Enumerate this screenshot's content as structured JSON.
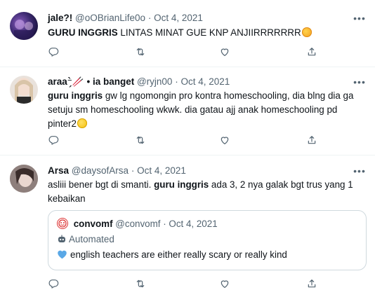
{
  "tweets": [
    {
      "name": "jale?!",
      "handle": "@oOBrianLife0o",
      "sep": "·",
      "date": "Oct 4, 2021",
      "bold_text": "GURU INGGRIS",
      "text_after": " LINTAS MINAT GUE KNP ANJIIRRRRRRR",
      "emoji": "kiss-face-emoji"
    },
    {
      "name": "araa⁻̗̀🥢 • ia banget",
      "handle": "@ryjn00",
      "sep": "·",
      "date": "Oct 4, 2021",
      "bold_text": "guru inggris",
      "text_after": " gw lg ngomongin pro kontra homeschooling, dia blng dia ga setuju sm homeschooling wkwk. dia gatau ajj anak homeschooling pd pinter2",
      "emoji": "grinning-face-emoji"
    },
    {
      "name": "Arsa",
      "handle": "@daysofArsa",
      "sep": "·",
      "date": "Oct 4, 2021",
      "text_before": "asliii bener bgt di smanti. ",
      "bold_text": "guru inggris",
      "text_after": " ada 3, 2 nya galak bgt trus yang 1 kebaikan",
      "quote": {
        "name": "convomf",
        "handle": "@convomf",
        "sep": "·",
        "date": "Oct 4, 2021",
        "automated_label": "Automated",
        "text": "english teachers are either really scary or really kind",
        "emoji": "blue-heart-emoji"
      }
    }
  ],
  "icons": {
    "reply": "reply-icon",
    "retweet": "retweet-icon",
    "like": "heart-icon",
    "share": "share-icon",
    "more": "more-icon"
  },
  "more_glyph": "•••",
  "colors": {
    "text": "#0f1419",
    "muted": "#536471",
    "border": "#eff3f4",
    "quote_border": "#cfd9de"
  }
}
